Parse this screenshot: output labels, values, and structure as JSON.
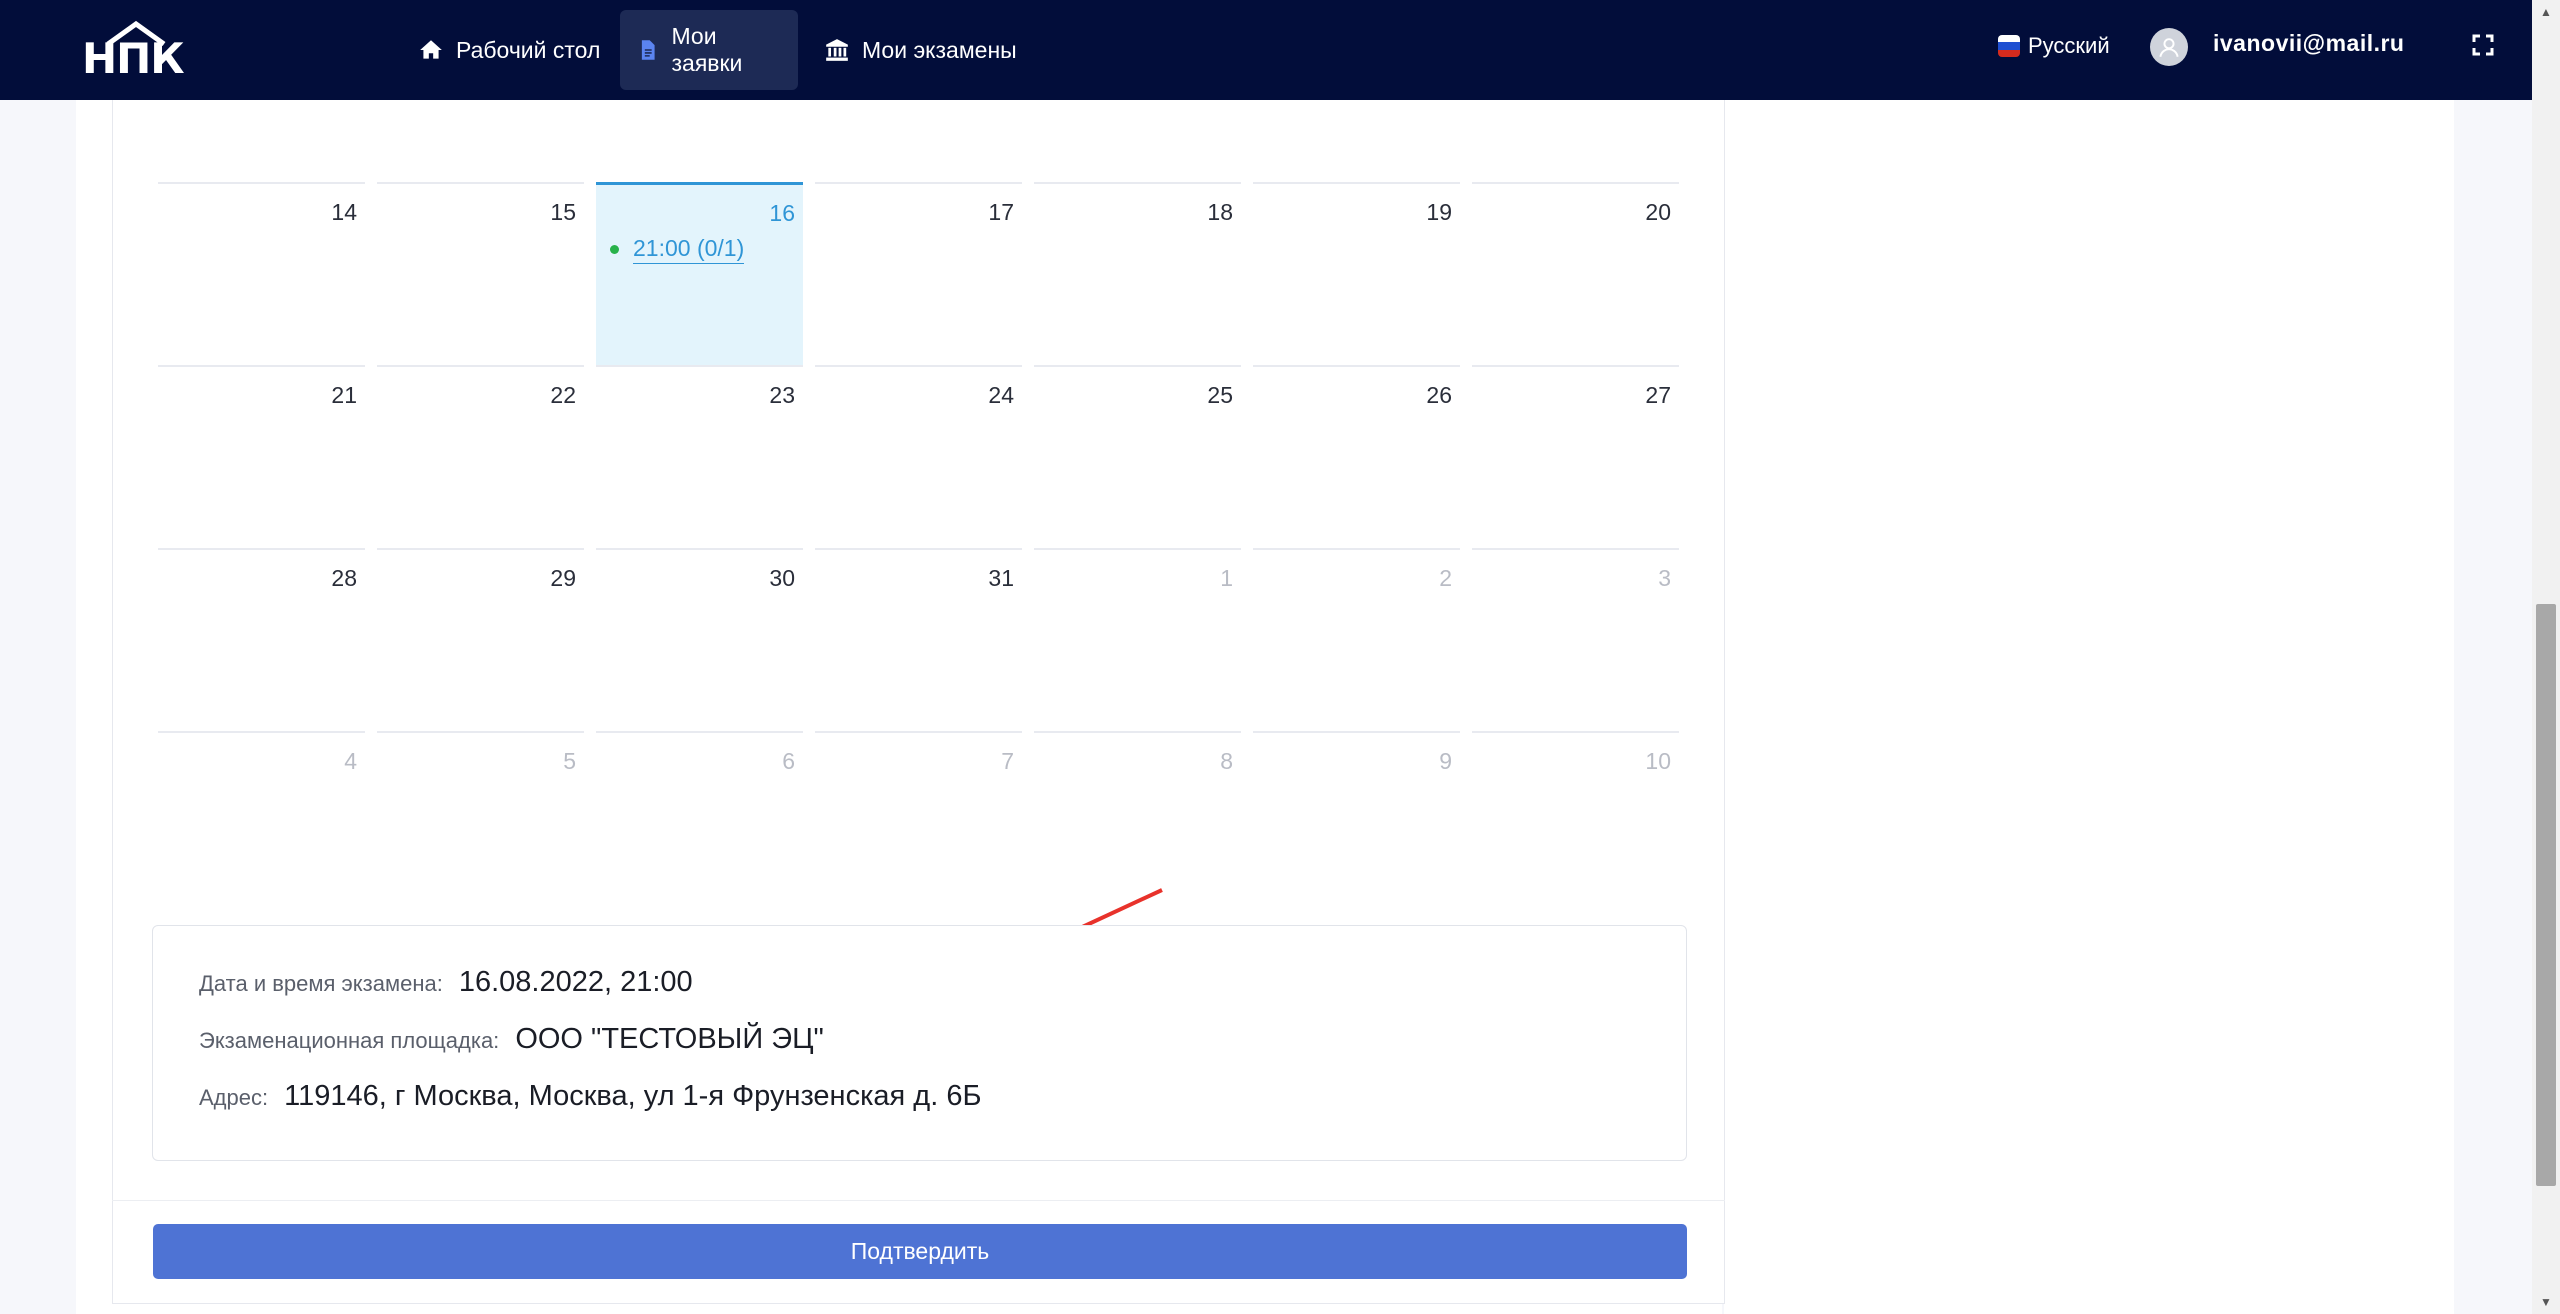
{
  "navbar": {
    "logo_text": "НПК",
    "items": [
      {
        "label": "Рабочий стол",
        "icon": "home-icon"
      },
      {
        "label": "Мои заявки",
        "icon": "document-icon",
        "active": true
      },
      {
        "label": "Мои экзамены",
        "icon": "institution-icon"
      }
    ],
    "language": "Русский",
    "user_email": "ivanovii@mail.ru"
  },
  "calendar": {
    "weeks": [
      [
        {
          "day": "14"
        },
        {
          "day": "15"
        },
        {
          "day": "16",
          "today": true,
          "event": "21:00 (0/1)"
        },
        {
          "day": "17"
        },
        {
          "day": "18"
        },
        {
          "day": "19"
        },
        {
          "day": "20"
        }
      ],
      [
        {
          "day": "21"
        },
        {
          "day": "22"
        },
        {
          "day": "23"
        },
        {
          "day": "24"
        },
        {
          "day": "25"
        },
        {
          "day": "26"
        },
        {
          "day": "27"
        }
      ],
      [
        {
          "day": "28"
        },
        {
          "day": "29"
        },
        {
          "day": "30"
        },
        {
          "day": "31"
        },
        {
          "day": "1",
          "muted": true
        },
        {
          "day": "2",
          "muted": true
        },
        {
          "day": "3",
          "muted": true
        }
      ],
      [
        {
          "day": "4",
          "muted": true
        },
        {
          "day": "5",
          "muted": true
        },
        {
          "day": "6",
          "muted": true
        },
        {
          "day": "7",
          "muted": true
        },
        {
          "day": "8",
          "muted": true
        },
        {
          "day": "9",
          "muted": true
        },
        {
          "day": "10",
          "muted": true
        }
      ]
    ]
  },
  "exam_info": {
    "datetime_label": "Дата и время экзамена:",
    "datetime_value": "16.08.2022, 21:00",
    "venue_label": "Экзаменационная площадка:",
    "venue_value": "ООО \"ТЕСТОВЫЙ ЭЦ\"",
    "address_label": "Адрес:",
    "address_value": "119146, г Москва, Москва, ул 1-я Фрунзенская д. 6Б"
  },
  "confirm_label": "Подтвердить",
  "colors": {
    "navbar_bg": "#020d3a",
    "accent": "#2f95d6",
    "button": "#4e73d4",
    "event_dot": "#27b24a",
    "annotation_arrow": "#e8322b"
  }
}
